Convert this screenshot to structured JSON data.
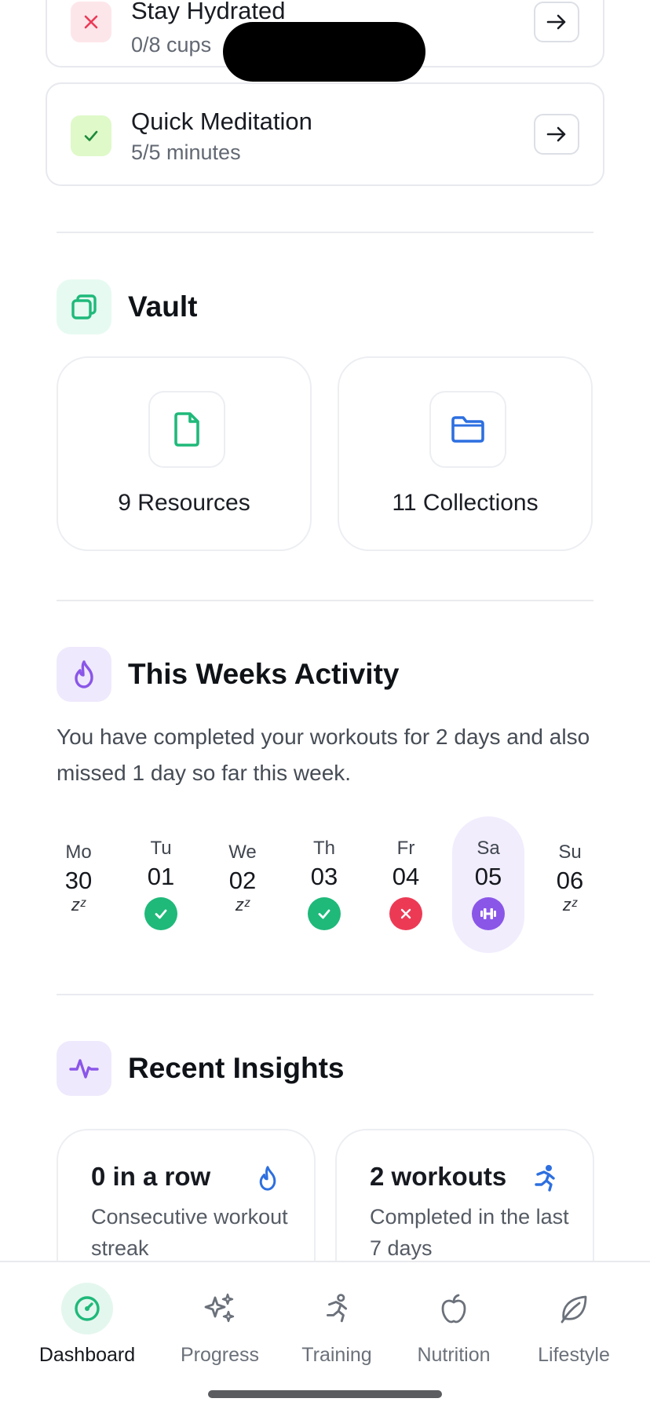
{
  "tasks": [
    {
      "title": "Stay Hydrated",
      "subtitle": "0/8 cups",
      "status": "missed"
    },
    {
      "title": "Quick Meditation",
      "subtitle": "5/5 minutes",
      "status": "done"
    }
  ],
  "vault": {
    "title": "Vault",
    "resources_label": "9 Resources",
    "collections_label": "11 Collections"
  },
  "activity": {
    "title": "This Weeks Activity",
    "description": "You have completed your workouts for 2 days and also missed 1 day so far this week.",
    "days": [
      {
        "dow": "Mo",
        "num": "30",
        "state": "rest",
        "rest_text": "zᶻ"
      },
      {
        "dow": "Tu",
        "num": "01",
        "state": "done"
      },
      {
        "dow": "We",
        "num": "02",
        "state": "rest",
        "rest_text": "zᶻ"
      },
      {
        "dow": "Th",
        "num": "03",
        "state": "done"
      },
      {
        "dow": "Fr",
        "num": "04",
        "state": "missed"
      },
      {
        "dow": "Sa",
        "num": "05",
        "state": "today"
      },
      {
        "dow": "Su",
        "num": "06",
        "state": "rest",
        "rest_text": "zᶻ"
      }
    ]
  },
  "insights": {
    "title": "Recent Insights",
    "cards": [
      {
        "title": "0 in a row",
        "description": "Consecutive workout streak",
        "icon": "flame-icon"
      },
      {
        "title": "2 workouts",
        "description": "Completed in the last 7 days",
        "icon": "runner-icon"
      }
    ]
  },
  "tabs": [
    {
      "label": "Dashboard",
      "icon": "gauge-icon",
      "active": true
    },
    {
      "label": "Progress",
      "icon": "sparkles-icon",
      "active": false
    },
    {
      "label": "Training",
      "icon": "runner-icon",
      "active": false
    },
    {
      "label": "Nutrition",
      "icon": "apple-icon",
      "active": false
    },
    {
      "label": "Lifestyle",
      "icon": "leaf-icon",
      "active": false
    }
  ],
  "colors": {
    "green": "#1fb97a",
    "red": "#ec3a55",
    "purple": "#8a56e8",
    "blue": "#2d6fe0"
  }
}
